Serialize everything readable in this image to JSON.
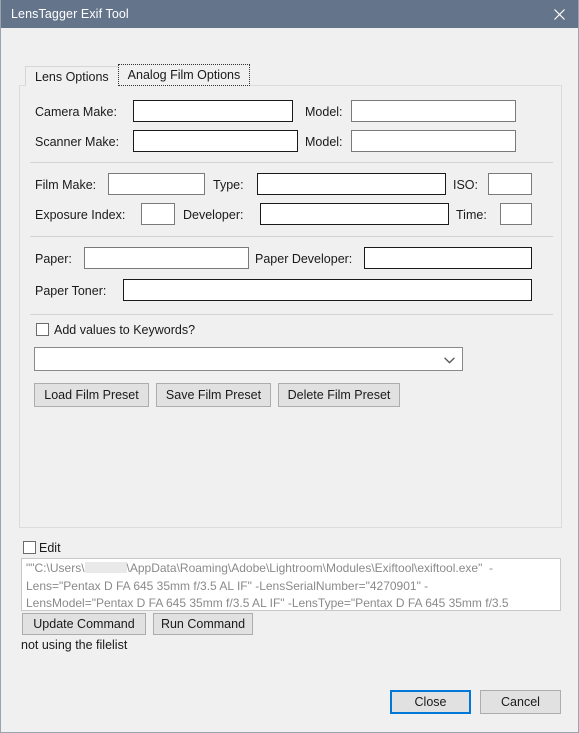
{
  "window": {
    "title": "LensTagger Exif Tool",
    "close_icon": "close-icon"
  },
  "tabs": [
    {
      "label": "Lens Options",
      "active": false
    },
    {
      "label": "Analog Film Options",
      "active": true
    }
  ],
  "form": {
    "camera_make": {
      "label": "Camera Make:",
      "value": "",
      "placeholder": ""
    },
    "camera_model": {
      "label": "Model:",
      "value": "",
      "placeholder": ""
    },
    "scanner_make": {
      "label": "Scanner Make:",
      "value": "",
      "placeholder": ""
    },
    "scanner_model": {
      "label": "Model:",
      "value": "",
      "placeholder": ""
    },
    "film_make": {
      "label": "Film Make:",
      "value": "",
      "placeholder": ""
    },
    "film_type": {
      "label": "Type:",
      "value": "",
      "placeholder": ""
    },
    "iso": {
      "label": "ISO:",
      "value": "",
      "placeholder": ""
    },
    "exposure_index": {
      "label": "Exposure Index:",
      "value": "",
      "placeholder": ""
    },
    "developer": {
      "label": "Developer:",
      "value": "",
      "placeholder": ""
    },
    "time": {
      "label": "Time:",
      "value": "",
      "placeholder": ""
    },
    "paper": {
      "label": "Paper:",
      "value": "",
      "placeholder": ""
    },
    "paper_developer": {
      "label": "Paper Developer:",
      "value": "",
      "placeholder": ""
    },
    "paper_toner": {
      "label": "Paper Toner:",
      "value": "",
      "placeholder": ""
    }
  },
  "keywords": {
    "label": "Add values to Keywords?",
    "checked": false
  },
  "preset": {
    "selected": "",
    "dropdown_icon": "chevron-down-icon",
    "load_label": "Load Film Preset",
    "save_label": "Save Film Preset",
    "delete_label": "Delete Film Preset"
  },
  "command": {
    "edit_label": "Edit",
    "edit_checked": false,
    "line1_prefix": "\"\"C:\\Users\\",
    "line1_suffix": "\\AppData\\Roaming\\Adobe\\Lightroom\\Modules\\Exiftool\\exiftool.exe\"  -",
    "line2": "Lens=\"Pentax D FA 645 35mm f/3.5 AL IF\" -LensSerialNumber=\"4270901\" -",
    "line3": "LensModel=\"Pentax D FA 645 35mm f/3.5 AL IF\" -LensType=\"Pentax D FA 645 35mm f/3.5",
    "update_label": "Update Command",
    "run_label": "Run Command",
    "status": "not using the filelist"
  },
  "footer": {
    "close_label": "Close",
    "cancel_label": "Cancel"
  },
  "colors": {
    "titlebar": "#64748b",
    "window_bg": "#f0f0f0",
    "accent": "#0078d7",
    "field_border": "#7a7a7a",
    "readonly_text": "#8a8a8a"
  }
}
